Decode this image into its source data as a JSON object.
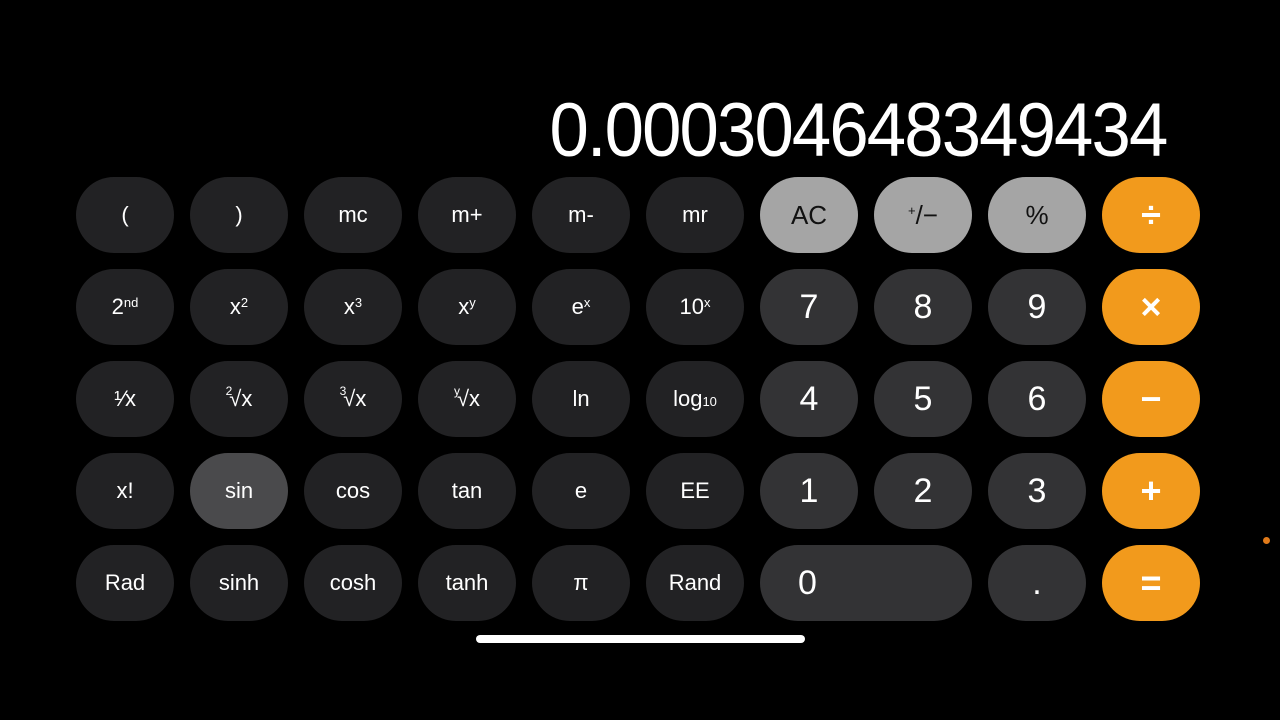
{
  "display": {
    "value": "0.000304648349434"
  },
  "colors": {
    "background": "#000000",
    "scientific_key": "#222224",
    "scientific_key_pressed": "#4a4a4c",
    "digit_key": "#333335",
    "function_key": "#a5a5a5",
    "operator_key": "#f29a1c",
    "indicator_dot": "#e07a1a"
  },
  "keys": {
    "row1": {
      "open_paren": "(",
      "close_paren": ")",
      "mc": "mc",
      "m_plus": "m+",
      "m_minus": "m-",
      "mr": "mr",
      "ac": "AC",
      "plus_minus_base": "+",
      "plus_minus_rest": "/−",
      "percent": "%",
      "divide": "÷"
    },
    "row2": {
      "second_base": "2",
      "second_sup": "nd",
      "x_squared_base": "x",
      "x_squared_sup": "2",
      "x_cubed_base": "x",
      "x_cubed_sup": "3",
      "x_pow_y_base": "x",
      "x_pow_y_sup": "y",
      "e_pow_x_base": "e",
      "e_pow_x_sup": "x",
      "ten_pow_x_base": "10",
      "ten_pow_x_sup": "x",
      "seven": "7",
      "eight": "8",
      "nine": "9",
      "multiply": "×"
    },
    "row3": {
      "reciprocal": "¹⁄x",
      "sqrt_index": "2",
      "sqrt_body": "√x",
      "cbrt_index": "3",
      "cbrt_body": "√x",
      "yroot_index": "y",
      "yroot_body": "√x",
      "ln": "ln",
      "log_base": "log",
      "log_sub": "10",
      "four": "4",
      "five": "5",
      "six": "6",
      "minus": "−"
    },
    "row4": {
      "factorial": "x!",
      "sin": "sin",
      "cos": "cos",
      "tan": "tan",
      "e": "e",
      "ee": "EE",
      "one": "1",
      "two": "2",
      "three": "3",
      "plus": "+"
    },
    "row5": {
      "rad": "Rad",
      "sinh": "sinh",
      "cosh": "cosh",
      "tanh": "tanh",
      "pi": "π",
      "rand": "Rand",
      "zero": "0",
      "decimal": ".",
      "equals": "="
    }
  },
  "state": {
    "pressed_key": "sin"
  }
}
